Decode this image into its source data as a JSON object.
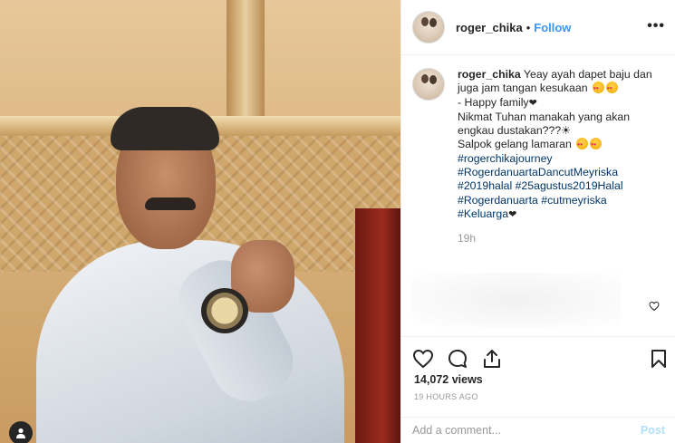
{
  "header": {
    "username": "roger_chika",
    "separator": "•",
    "follow_label": "Follow",
    "more_label": "•••"
  },
  "caption": {
    "username": "roger_chika",
    "lines": [
      "Yeay ayah dapet baju dan",
      "juga jam tangan kesukaan",
      "- Happy family",
      "Nikmat Tuhan manakah yang akan",
      "engkau dustakan???☀",
      "Salpok gelang lamaran",
      "#rogerchikajourney",
      "#RogerdanuartaDancutMeyriska",
      "#2019halal #25agustus2019Halal",
      "#Rogerdanuarta #cutmeyriska",
      "#Keluarga"
    ],
    "time": "19h"
  },
  "stats": {
    "views": "14,072 views",
    "timestamp": "19 HOURS AGO"
  },
  "comment_box": {
    "placeholder": "Add a comment...",
    "post_label": "Post"
  },
  "icons": {
    "like": "heart-icon",
    "comment": "comment-icon",
    "share": "share-icon",
    "save": "bookmark-icon",
    "tag": "user-tag-icon"
  },
  "colors": {
    "link_blue": "#3897f0",
    "hashtag": "#003569",
    "muted": "#999999",
    "post_disabled": "#b2dffc",
    "text": "#262626"
  }
}
